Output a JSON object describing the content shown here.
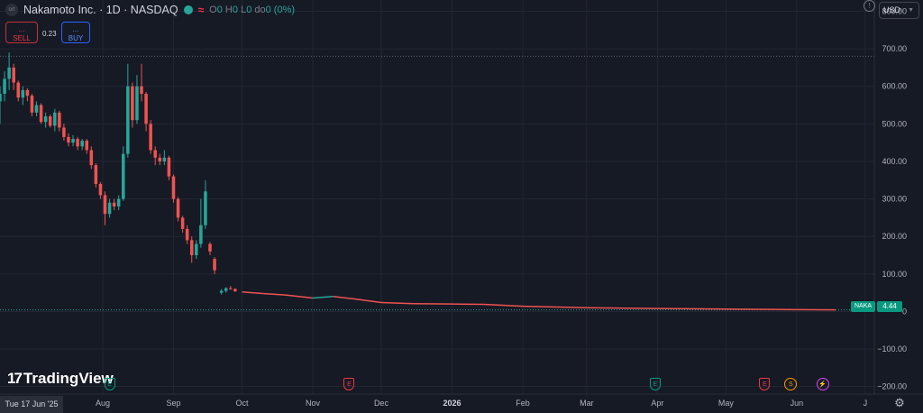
{
  "header": {
    "symbol_logo": "ort",
    "title": "Nakamoto Inc. · 1D · NASDAQ",
    "ohlc": [
      {
        "key": "O",
        "value": "0"
      },
      {
        "key": "H",
        "value": "0"
      },
      {
        "key": "L",
        "value": "0"
      },
      {
        "key": "do",
        "value": "0 (0%)"
      }
    ],
    "sell_label": "SELL",
    "sell_price": "...",
    "buy_label": "BUY",
    "buy_price": "...",
    "spread": "0.23",
    "currency": "USD"
  },
  "footer": {
    "brand": "TradingView",
    "crosshair_date": "Tue 17 Jun '25"
  },
  "price_tag": {
    "symbol": "NAKA",
    "value": "4.44"
  },
  "colors": {
    "up": "#26a69a",
    "down": "#ef5350",
    "background": "#161a25",
    "grid": "#232733",
    "text": "#b2b5be"
  },
  "events": [
    {
      "icon": "E",
      "kind": "earnings",
      "color": "#089981",
      "date": "2025-08-04"
    },
    {
      "icon": "E",
      "kind": "earnings",
      "color": "#f23645",
      "date": "2025-11-17"
    },
    {
      "icon": "E",
      "kind": "earnings",
      "color": "#089981",
      "date": "2026-03-31"
    },
    {
      "icon": "E",
      "kind": "earnings",
      "color": "#f23645",
      "date": "2026-05-18"
    },
    {
      "icon": "S",
      "kind": "split",
      "color": "#ff9800",
      "date": "2026-05-29"
    },
    {
      "icon": "⚡",
      "kind": "news",
      "color": "#e040fb",
      "date": "2026-06-12"
    }
  ],
  "chart_data": {
    "type": "candlestick",
    "symbol": "NAKA",
    "timeframe": "1D",
    "y_axis": {
      "ticks": [
        800,
        700,
        600,
        500,
        400,
        300,
        200,
        100,
        0,
        -100,
        -200
      ],
      "tick_labels": [
        "800.00",
        "700.00",
        "600.00",
        "500.00",
        "400.00",
        "300.00",
        "200.00",
        "100.00",
        "0",
        "−100.00",
        "−200.00"
      ],
      "range": [
        -220,
        830
      ]
    },
    "x_axis": {
      "tick_labels": [
        "Aug",
        "Sep",
        "Oct",
        "Nov",
        "Dec",
        "2026",
        "Feb",
        "Mar",
        "Apr",
        "May",
        "Jun",
        "J"
      ],
      "tick_dates": [
        "2025-08-01",
        "2025-09-01",
        "2025-10-01",
        "2025-11-01",
        "2025-12-01",
        "2026-01-01",
        "2026-02-01",
        "2026-03-01",
        "2026-04-01",
        "2026-05-01",
        "2026-06-01",
        "2026-07-01"
      ],
      "range": [
        "2025-06-17",
        "2026-07-05"
      ]
    },
    "reference_lines": [
      {
        "value": 680,
        "style": "dotted"
      },
      {
        "value": 4.44,
        "style": "dotted"
      }
    ],
    "last_price": 4.44,
    "candles": [
      [
        "2025-06-17",
        560,
        600,
        500,
        580
      ],
      [
        "2025-06-19",
        580,
        640,
        560,
        620
      ],
      [
        "2025-06-21",
        620,
        690,
        590,
        650
      ],
      [
        "2025-06-23",
        650,
        660,
        590,
        610
      ],
      [
        "2025-06-25",
        610,
        615,
        560,
        570
      ],
      [
        "2025-06-27",
        570,
        600,
        550,
        590
      ],
      [
        "2025-06-29",
        590,
        595,
        560,
        575
      ],
      [
        "2025-07-01",
        575,
        580,
        520,
        530
      ],
      [
        "2025-07-03",
        530,
        560,
        520,
        550
      ],
      [
        "2025-07-05",
        550,
        555,
        500,
        505
      ],
      [
        "2025-07-07",
        505,
        530,
        490,
        520
      ],
      [
        "2025-07-09",
        520,
        525,
        490,
        495
      ],
      [
        "2025-07-11",
        495,
        540,
        480,
        530
      ],
      [
        "2025-07-13",
        530,
        535,
        480,
        490
      ],
      [
        "2025-07-15",
        490,
        500,
        455,
        465
      ],
      [
        "2025-07-17",
        465,
        475,
        440,
        450
      ],
      [
        "2025-07-19",
        450,
        470,
        440,
        460
      ],
      [
        "2025-07-21",
        460,
        465,
        430,
        440
      ],
      [
        "2025-07-23",
        440,
        460,
        430,
        455
      ],
      [
        "2025-07-25",
        455,
        460,
        420,
        430
      ],
      [
        "2025-07-27",
        430,
        440,
        380,
        390
      ],
      [
        "2025-07-29",
        390,
        395,
        330,
        340
      ],
      [
        "2025-07-31",
        340,
        345,
        300,
        310
      ],
      [
        "2025-08-02",
        310,
        320,
        230,
        260
      ],
      [
        "2025-08-04",
        260,
        300,
        250,
        290
      ],
      [
        "2025-08-06",
        290,
        300,
        270,
        280
      ],
      [
        "2025-08-08",
        280,
        310,
        270,
        300
      ],
      [
        "2025-08-10",
        300,
        440,
        295,
        420
      ],
      [
        "2025-08-12",
        420,
        660,
        410,
        600
      ],
      [
        "2025-08-14",
        600,
        610,
        490,
        510
      ],
      [
        "2025-08-16",
        510,
        630,
        500,
        600
      ],
      [
        "2025-08-18",
        600,
        660,
        560,
        580
      ],
      [
        "2025-08-20",
        580,
        585,
        480,
        500
      ],
      [
        "2025-08-22",
        500,
        510,
        420,
        430
      ],
      [
        "2025-08-24",
        430,
        440,
        390,
        410
      ],
      [
        "2025-08-26",
        410,
        420,
        390,
        400
      ],
      [
        "2025-08-28",
        400,
        430,
        390,
        410
      ],
      [
        "2025-08-30",
        410,
        415,
        350,
        360
      ],
      [
        "2025-09-01",
        360,
        365,
        290,
        300
      ],
      [
        "2025-09-03",
        300,
        305,
        240,
        250
      ],
      [
        "2025-09-05",
        250,
        255,
        210,
        220
      ],
      [
        "2025-09-07",
        220,
        230,
        180,
        190
      ],
      [
        "2025-09-09",
        190,
        200,
        130,
        150
      ],
      [
        "2025-09-11",
        150,
        190,
        140,
        180
      ],
      [
        "2025-09-13",
        180,
        300,
        170,
        230
      ],
      [
        "2025-09-15",
        230,
        350,
        220,
        320
      ],
      [
        "2025-09-17",
        180,
        185,
        150,
        160
      ],
      [
        "2025-09-19",
        140,
        145,
        100,
        110
      ],
      [
        "2025-09-22",
        50,
        60,
        45,
        55
      ],
      [
        "2025-09-24",
        55,
        65,
        50,
        62
      ],
      [
        "2025-09-26",
        62,
        68,
        58,
        60
      ],
      [
        "2025-09-28",
        60,
        62,
        52,
        54
      ]
    ],
    "tail_line": [
      [
        "2025-10-01",
        52
      ],
      [
        "2025-10-10",
        48
      ],
      [
        "2025-10-20",
        44
      ],
      [
        "2025-11-01",
        36
      ],
      [
        "2025-11-10",
        40
      ],
      [
        "2025-11-20",
        33
      ],
      [
        "2025-12-01",
        24
      ],
      [
        "2025-12-15",
        21
      ],
      [
        "2026-01-01",
        20
      ],
      [
        "2026-01-15",
        19
      ],
      [
        "2026-02-01",
        14
      ],
      [
        "2026-03-01",
        10
      ],
      [
        "2026-04-01",
        8
      ],
      [
        "2026-05-01",
        6.5
      ],
      [
        "2026-06-01",
        5
      ],
      [
        "2026-06-18",
        4.44
      ]
    ]
  }
}
